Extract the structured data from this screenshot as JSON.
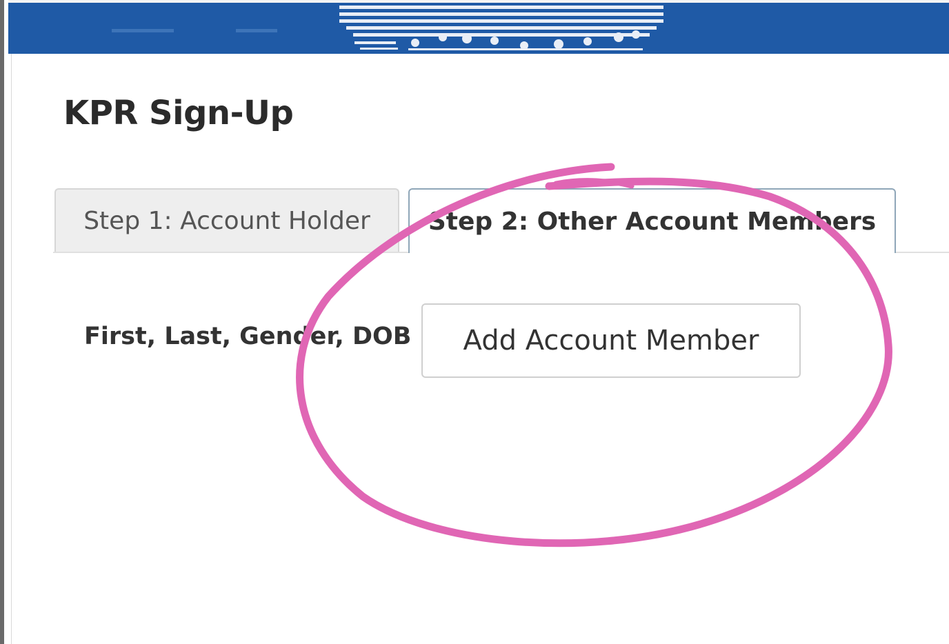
{
  "header": {
    "title": "KPR Sign-Up"
  },
  "tabs": [
    {
      "label": "Step 1: Account Holder",
      "active": false
    },
    {
      "label": "Step 2: Other Account Members",
      "active": true
    }
  ],
  "form": {
    "fields_label": "First, Last, Gender, DOB",
    "add_member_label": "Add Account Member"
  },
  "colors": {
    "banner": "#1f5aa6",
    "annotation": "#e066b4"
  },
  "icons": {
    "banner_logo": "organization-logo-icon"
  }
}
